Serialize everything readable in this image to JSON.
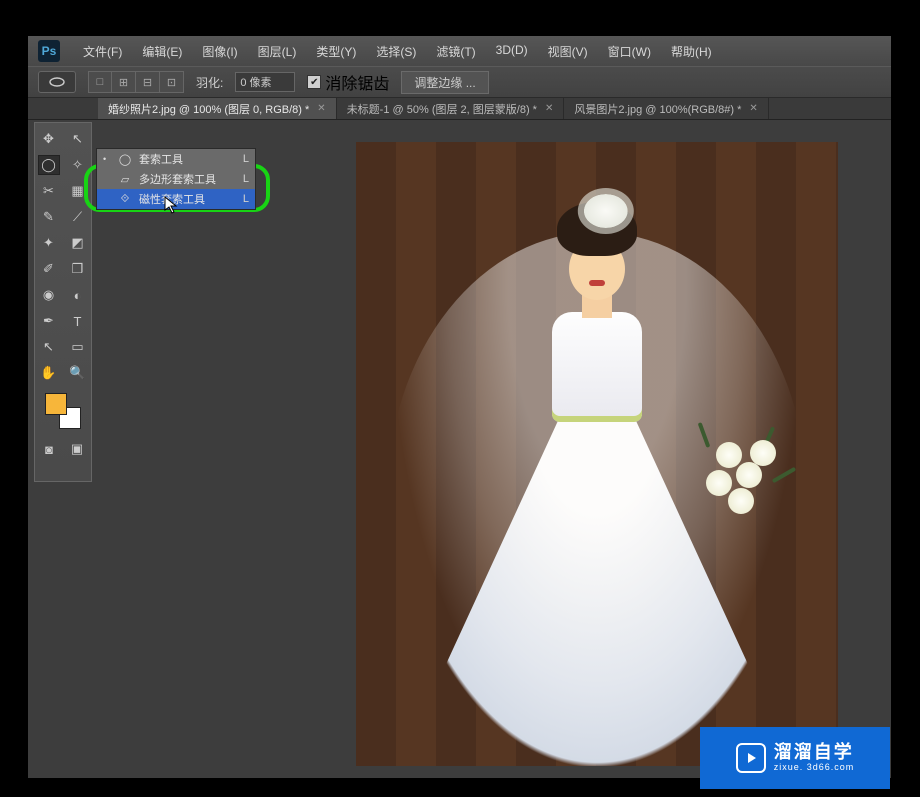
{
  "logo": "Ps",
  "menu": [
    "文件(F)",
    "编辑(E)",
    "图像(I)",
    "图层(L)",
    "类型(Y)",
    "选择(S)",
    "滤镜(T)",
    "3D(D)",
    "视图(V)",
    "窗口(W)",
    "帮助(H)"
  ],
  "options": {
    "feather_label": "羽化:",
    "feather_value": "0 像素",
    "antialias": "消除锯齿",
    "refine_edge": "调整边缘 ..."
  },
  "tabs": [
    {
      "label": "婚纱照片2.jpg @ 100% (图层 0, RGB/8) *",
      "active": true
    },
    {
      "label": "未标题-1 @ 50% (图层 2, 图层蒙版/8) *",
      "active": false
    },
    {
      "label": "风景图片2.jpg @ 100%(RGB/8#) *",
      "active": false
    }
  ],
  "tools": [
    {
      "name": "move-tool",
      "glyph": "✥"
    },
    {
      "name": "artboard-tool",
      "glyph": "↖"
    },
    {
      "name": "lasso-tool",
      "glyph": "◯",
      "selected": true
    },
    {
      "name": "magic-wand-tool",
      "glyph": "✧"
    },
    {
      "name": "crop-tool",
      "glyph": "✂"
    },
    {
      "name": "slice-tool",
      "glyph": "▦"
    },
    {
      "name": "eyedropper-tool",
      "glyph": "✎"
    },
    {
      "name": "ruler-tool",
      "glyph": "⟋"
    },
    {
      "name": "healing-brush-tool",
      "glyph": "✦"
    },
    {
      "name": "patch-tool",
      "glyph": "◩"
    },
    {
      "name": "brush-tool",
      "glyph": "✐"
    },
    {
      "name": "clone-stamp-tool",
      "glyph": "❒"
    },
    {
      "name": "blur-tool",
      "glyph": "◉"
    },
    {
      "name": "dodge-tool",
      "glyph": "◐"
    },
    {
      "name": "pen-tool",
      "glyph": "✒"
    },
    {
      "name": "type-tool",
      "glyph": "T"
    },
    {
      "name": "path-select-tool",
      "glyph": "↖"
    },
    {
      "name": "shape-tool",
      "glyph": "▭"
    },
    {
      "name": "hand-tool",
      "glyph": "✋"
    },
    {
      "name": "zoom-tool",
      "glyph": "🔍"
    }
  ],
  "swatches": {
    "fg": "#f7b63a",
    "bg": "#ffffff"
  },
  "flyout": [
    {
      "label": "套索工具",
      "shortcut": "L",
      "dot": "•",
      "hl": false,
      "icon": "◯"
    },
    {
      "label": "多边形套索工具",
      "shortcut": "L",
      "dot": "",
      "hl": false,
      "icon": "▱"
    },
    {
      "label": "磁性套索工具",
      "shortcut": "L",
      "dot": "",
      "hl": true,
      "icon": "⟐"
    }
  ],
  "watermark": {
    "main": "溜溜自学",
    "sub": "zixue. 3d66.com"
  }
}
